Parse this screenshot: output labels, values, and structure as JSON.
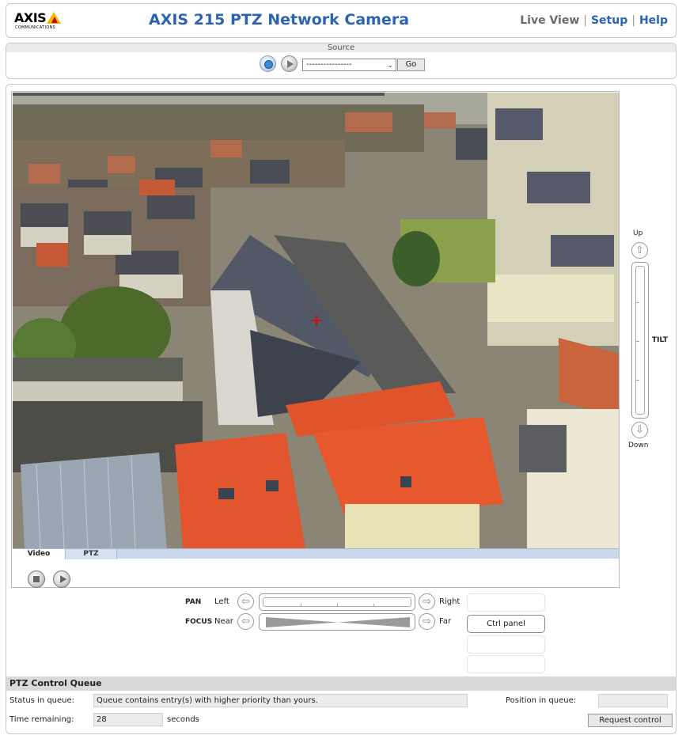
{
  "header": {
    "logo_text": "AXIS",
    "logo_sub": "COMMUNICATIONS",
    "title": "AXIS 215 PTZ Network Camera",
    "nav": {
      "live_view": "Live View",
      "setup": "Setup",
      "help": "Help",
      "separator": "|"
    }
  },
  "source": {
    "label": "Source",
    "select_value": "----------------",
    "go_label": "Go"
  },
  "video": {
    "tabs": [
      "Video",
      "PTZ"
    ],
    "active_tab": "Video"
  },
  "tilt": {
    "up": "Up",
    "label": "TILT",
    "down": "Down"
  },
  "pan": {
    "label": "PAN",
    "left": "Left",
    "right": "Right"
  },
  "focus": {
    "label": "FOCUS",
    "near": "Near",
    "far": "Far"
  },
  "ctrl_panel_label": "Ctrl panel",
  "queue": {
    "title": "PTZ Control Queue",
    "status_label": "Status in queue:",
    "status_value": "Queue contains entry(s) with higher priority than yours.",
    "position_label": "Position in queue:",
    "position_value": "",
    "time_label": "Time remaining:",
    "time_value": "28",
    "time_unit": "seconds",
    "request_label": "Request control"
  },
  "icons": {
    "snapshot": "snapshot-icon",
    "play_source": "play-icon",
    "stop": "stop-icon",
    "play": "play-icon",
    "arrow_up": "arrow-up-icon",
    "arrow_down": "arrow-down-icon",
    "arrow_left": "arrow-left-icon",
    "arrow_right": "arrow-right-icon",
    "crosshair": "crosshair-icon"
  },
  "colors": {
    "title_blue": "#2c63b3",
    "roof_orange": "#e0542c",
    "crosshair": "#d01010"
  }
}
